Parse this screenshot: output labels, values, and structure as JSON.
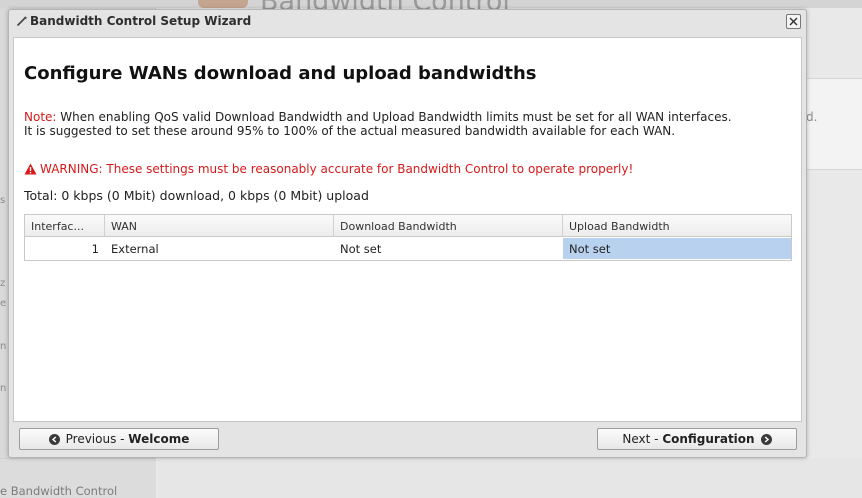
{
  "background": {
    "page_title": "Bandwidth Control",
    "right_fragment": "d.",
    "bottom_left_label": "e Bandwidth Control",
    "left_fragments": [
      "s",
      "z",
      "e",
      "n",
      "n"
    ]
  },
  "wizard": {
    "title": "Bandwidth Control Setup Wizard",
    "heading": "Configure WANs download and upload bandwidths",
    "note_label": "Note:",
    "note_text": " When enabling QoS valid Download Bandwidth and Upload Bandwidth limits must be set for all WAN interfaces.",
    "note_text2": "It is suggested to set these around 95% to 100% of the actual measured bandwidth available for each WAN.",
    "warning": "WARNING: These settings must be reasonably accurate for Bandwidth Control to operate properly!",
    "total": "Total: 0 kbps (0 Mbit) download, 0 kbps (0 Mbit) upload",
    "grid": {
      "columns": [
        "Interfac...",
        "WAN",
        "Download Bandwidth",
        "Upload Bandwidth"
      ],
      "rows": [
        {
          "interface": "1",
          "wan": "External",
          "download": "Not set",
          "upload": "Not set"
        }
      ]
    },
    "buttons": {
      "prev_prefix": "Previous - ",
      "prev_label": "Welcome",
      "next_prefix": "Next - ",
      "next_label": "Configuration"
    }
  },
  "colors": {
    "note_red": "#d61a1a",
    "selected_cell": "#b8d1ef"
  }
}
